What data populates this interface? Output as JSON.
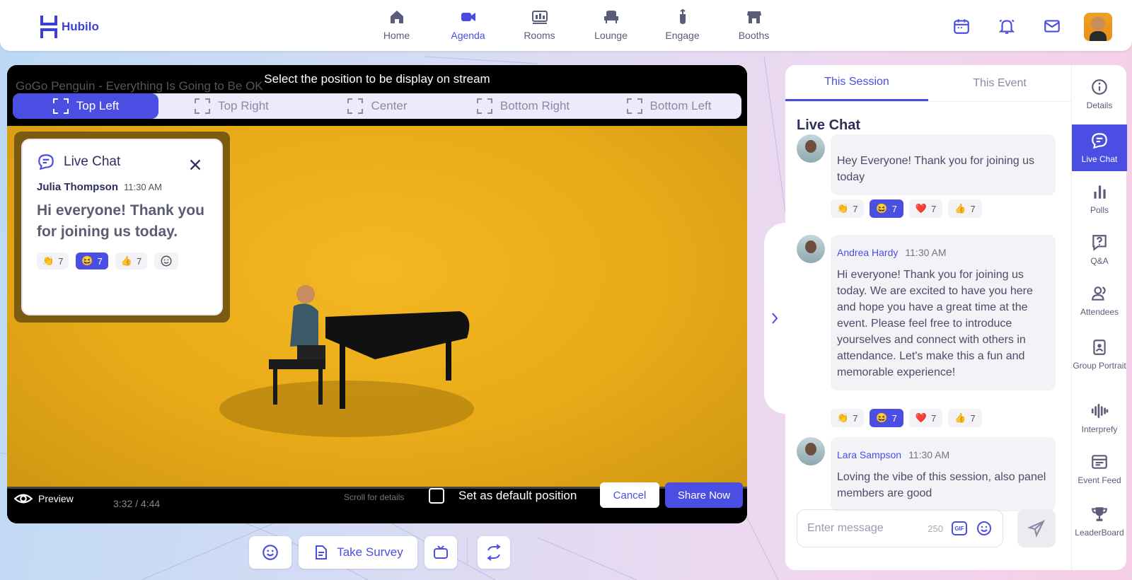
{
  "app": {
    "logo_text": "Hubilo"
  },
  "nav": {
    "items": [
      {
        "label": "Home",
        "icon": "home-icon"
      },
      {
        "label": "Agenda",
        "icon": "video-icon",
        "active": true
      },
      {
        "label": "Rooms",
        "icon": "rooms-icon"
      },
      {
        "label": "Lounge",
        "icon": "lounge-icon"
      },
      {
        "label": "Engage",
        "icon": "engage-icon"
      },
      {
        "label": "Booths",
        "icon": "booth-icon"
      }
    ],
    "active_color": "#4b4ee3"
  },
  "video": {
    "yt_title": "GoGo Penguin - Everything Is Going to Be OK",
    "banner": "Select the position to be display on stream",
    "positions": [
      "Top Left",
      "Top Right",
      "Center",
      "Bottom Right",
      "Bottom Left"
    ],
    "active_position": "Top Left",
    "preview_label": "Preview",
    "time": "3:32 / 4:44",
    "scroll_hint": "Scroll for details",
    "default_label": "Set as default position",
    "cancel_label": "Cancel",
    "share_label": "Share Now"
  },
  "overlay_chat": {
    "title": "Live Chat",
    "author": "Julia Thompson",
    "time": "11:30 AM",
    "message": "Hi everyone! Thank you for joining us today.",
    "reactions": [
      {
        "emoji": "👏",
        "count": "7"
      },
      {
        "emoji": "😆",
        "count": "7",
        "active": true
      },
      {
        "emoji": "👍",
        "count": "7"
      }
    ]
  },
  "toolbar": {
    "survey_label": "Take Survey"
  },
  "panel": {
    "tabs": [
      "This Session",
      "This Event"
    ],
    "title": "Live Chat",
    "messages": [
      {
        "text": "Hey Everyone! Thank you for joining us today",
        "reactions": [
          {
            "emoji": "👏",
            "count": "7"
          },
          {
            "emoji": "😆",
            "count": "7",
            "active": true
          },
          {
            "emoji": "❤️",
            "count": "7"
          },
          {
            "emoji": "👍",
            "count": "7"
          }
        ]
      },
      {
        "author": "Andrea Hardy",
        "time": "11:30 AM",
        "text": "Hi everyone! Thank you for joining us today. We are excited to have you here and hope you have a great time at the event. Please feel free to introduce yourselves and connect with others in attendance. Let's make this a fun and memorable experience!",
        "reactions": [
          {
            "emoji": "👏",
            "count": "7"
          },
          {
            "emoji": "😆",
            "count": "7",
            "active": true
          },
          {
            "emoji": "❤️",
            "count": "7"
          },
          {
            "emoji": "👍",
            "count": "7"
          }
        ]
      },
      {
        "author": "Lara Sampson",
        "time": "11:30 AM",
        "text": "Loving the vibe of this session, also panel members are good"
      }
    ],
    "composer_placeholder": "Enter message",
    "char_count": "250",
    "gif_label": "GIF"
  },
  "rail": {
    "items": [
      "Details",
      "Live Chat",
      "Polls",
      "Q&A",
      "Attendees",
      "Group Portrait",
      "Interprefy",
      "Event Feed",
      "LeaderBoard"
    ],
    "active": "Live Chat"
  }
}
